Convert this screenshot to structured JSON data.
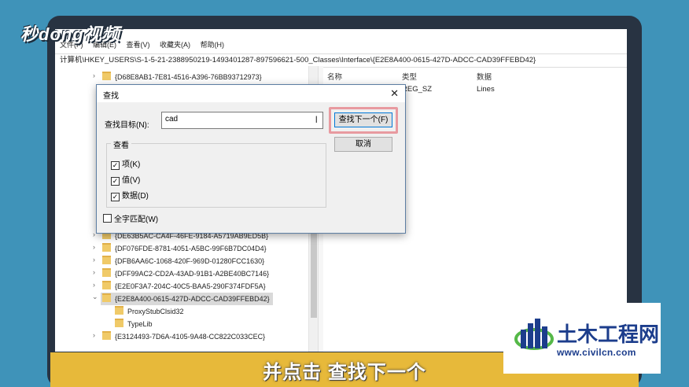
{
  "video_logo": "秒dong视频",
  "caption": "并点击 查找下一个",
  "regedit": {
    "menu": [
      "文件(F)",
      "编辑(E)",
      "查看(V)",
      "收藏夹(A)",
      "帮助(H)"
    ],
    "address": "计算机\\HKEY_USERS\\S-1-5-21-2388950219-1493401287-897596621-500_Classes\\Interface\\{E2E8A400-0615-427D-ADCC-CAD39FFEBD42}",
    "tree_items": [
      {
        "label": "{D68E8AB1-7E81-4516-A396-76BB93712973}",
        "level": 1,
        "expander": "chevron-right"
      },
      {
        "label": "{DE63B5AC-CA4F-46FE-9184-A5719AB9ED5B}",
        "level": 1,
        "expander": "chevron-right"
      },
      {
        "label": "{DF076FDE-8781-4051-A5BC-99F6B7DC04D4}",
        "level": 1,
        "expander": "chevron-right"
      },
      {
        "label": "{DFB6AA6C-1068-420F-969D-01280FCC1630}",
        "level": 1,
        "expander": "chevron-right"
      },
      {
        "label": "{DFF99AC2-CD2A-43AD-91B1-A2BE40BC7146}",
        "level": 1,
        "expander": "chevron-right"
      },
      {
        "label": "{E2E0F3A7-204C-40C5-BAA5-290F374FDF5A}",
        "level": 1,
        "expander": "chevron-right"
      },
      {
        "label": "{E2E8A400-0615-427D-ADCC-CAD39FFEBD42}",
        "level": 1,
        "expander": "chevron-down",
        "selected": true
      },
      {
        "label": "ProxyStubClsid32",
        "level": 2,
        "expander": "none"
      },
      {
        "label": "TypeLib",
        "level": 2,
        "expander": "none"
      },
      {
        "label": "{E3124493-7D6A-4105-9A48-CC822C033CEC}",
        "level": 1,
        "expander": "chevron-right"
      }
    ],
    "list_headers": {
      "name": "名称",
      "type": "类型",
      "data": "数据"
    },
    "list_row": {
      "type": "REG_SZ",
      "data": "Lines"
    }
  },
  "find_dialog": {
    "title": "查找",
    "find_label": "查找目标(N):",
    "find_value": "cad",
    "find_next": "查找下一个(F)",
    "cancel": "取消",
    "look_at": "查看",
    "options": [
      {
        "label": "项(K)",
        "checked": true
      },
      {
        "label": "值(V)",
        "checked": true
      },
      {
        "label": "数据(D)",
        "checked": true
      }
    ],
    "whole_string": {
      "label": "全字匹配(W)",
      "checked": false
    }
  },
  "civil_logo": {
    "name": "土木工程网",
    "url": "www.civilcn.com"
  },
  "colors": {
    "caption_bar": "#e7b93a",
    "highlight": "#e89aa0",
    "logo_blue": "#1c3d8c",
    "background": "#3f93b9"
  }
}
